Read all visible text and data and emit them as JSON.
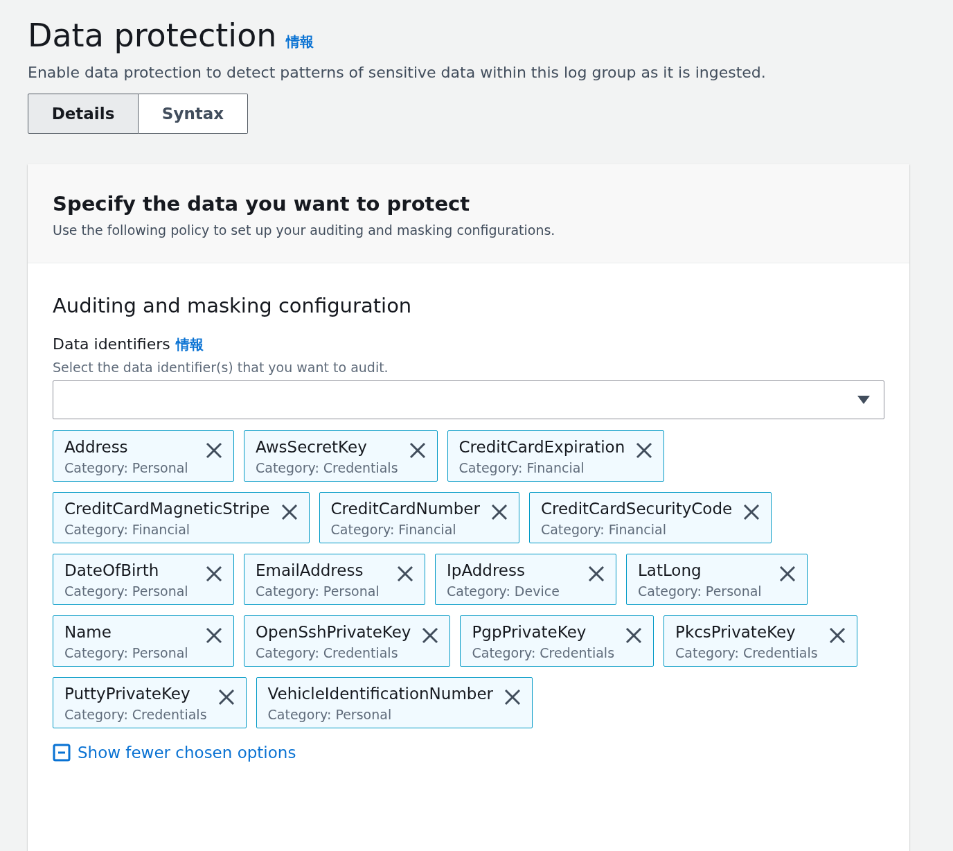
{
  "header": {
    "title": "Data protection",
    "info_link": "情報",
    "description": "Enable data protection to detect patterns of sensitive data within this log group as it is ingested."
  },
  "tabs": [
    {
      "label": "Details",
      "selected": true
    },
    {
      "label": "Syntax",
      "selected": false
    }
  ],
  "panel": {
    "title": "Specify the data you want to protect",
    "description": "Use the following policy to set up your auditing and masking configurations.",
    "section_title": "Auditing and masking configuration",
    "field": {
      "label": "Data identifiers",
      "info_link": "情報",
      "hint": "Select the data identifier(s) that you want to audit."
    },
    "tokens": [
      {
        "name": "Address",
        "category": "Category: Personal"
      },
      {
        "name": "AwsSecretKey",
        "category": "Category: Credentials"
      },
      {
        "name": "CreditCardExpiration",
        "category": "Category: Financial"
      },
      {
        "name": "CreditCardMagneticStripe",
        "category": "Category: Financial"
      },
      {
        "name": "CreditCardNumber",
        "category": "Category: Financial"
      },
      {
        "name": "CreditCardSecurityCode",
        "category": "Category: Financial"
      },
      {
        "name": "DateOfBirth",
        "category": "Category: Personal"
      },
      {
        "name": "EmailAddress",
        "category": "Category: Personal"
      },
      {
        "name": "IpAddress",
        "category": "Category: Device"
      },
      {
        "name": "LatLong",
        "category": "Category: Personal"
      },
      {
        "name": "Name",
        "category": "Category: Personal"
      },
      {
        "name": "OpenSshPrivateKey",
        "category": "Category: Credentials"
      },
      {
        "name": "PgpPrivateKey",
        "category": "Category: Credentials"
      },
      {
        "name": "PkcsPrivateKey",
        "category": "Category: Credentials"
      },
      {
        "name": "PuttyPrivateKey",
        "category": "Category: Credentials"
      },
      {
        "name": "VehicleIdentificationNumber",
        "category": "Category: Personal"
      }
    ],
    "toggle_link": "Show fewer chosen options"
  }
}
